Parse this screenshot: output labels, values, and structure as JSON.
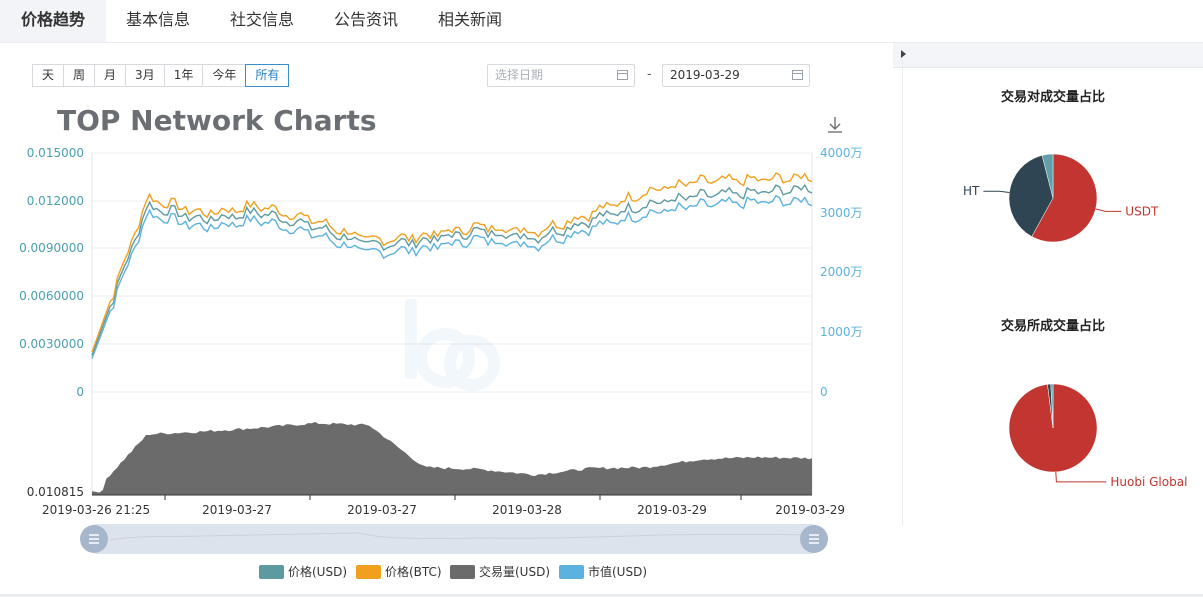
{
  "tabs": [
    {
      "label": "价格趋势",
      "active": true
    },
    {
      "label": "基本信息",
      "active": false
    },
    {
      "label": "社交信息",
      "active": false
    },
    {
      "label": "公告资讯",
      "active": false
    },
    {
      "label": "相关新闻",
      "active": false
    }
  ],
  "period_buttons": [
    {
      "label": "天"
    },
    {
      "label": "周"
    },
    {
      "label": "月"
    },
    {
      "label": "3月"
    },
    {
      "label": "1年"
    },
    {
      "label": "今年"
    },
    {
      "label": "所有",
      "active": true
    }
  ],
  "date_range": {
    "start_placeholder": "选择日期",
    "separator": "-",
    "end_value": "2019-03-29"
  },
  "colors": {
    "price_usd": "#5d9aa0",
    "price_btc": "#f0a01e",
    "volume": "#6b6b6b",
    "market_cap": "#5cb2de",
    "pie_usdt": "#c23531",
    "pie_ht": "#2f4554",
    "pie_small": "#61a0a8"
  },
  "chart": {
    "title": "TOP Network Charts",
    "download_icon": "download-icon",
    "left_ticks": [
      "0.015000",
      "0.012000",
      "0.0090000",
      "0.0060000",
      "0.0030000",
      "0"
    ],
    "right_ticks": [
      "4000万",
      "3000万",
      "2000万",
      "1000万",
      "0"
    ],
    "volume_min_label": "0.010815",
    "x_ticks": [
      "2019-03-26 21:25",
      "2019-03-27",
      "2019-03-27",
      "2019-03-28",
      "2019-03-29",
      "2019-03-29"
    ],
    "legend": [
      {
        "label": "价格(USD)",
        "color": "#5d9aa0"
      },
      {
        "label": "价格(BTC)",
        "color": "#f0a01e"
      },
      {
        "label": "交易量(USD)",
        "color": "#6b6b6b"
      },
      {
        "label": "市值(USD)",
        "color": "#5cb2de"
      }
    ]
  },
  "chart_data": {
    "type": "line",
    "title": "TOP Network Charts",
    "x": [
      "2019-03-26 21:25",
      "2019-03-27",
      "2019-03-27",
      "2019-03-28",
      "2019-03-29",
      "2019-03-29"
    ],
    "y_left_range": [
      0,
      0.015
    ],
    "y_right_range": [
      0,
      40000000
    ],
    "series": [
      {
        "name": "价格(USD)",
        "values": [
          0.0023,
          0.0117,
          0.0108,
          0.0113,
          0.0104,
          0.0092,
          0.0095,
          0.0101,
          0.0097,
          0.0108,
          0.0118,
          0.0123,
          0.0125,
          0.0128
        ]
      },
      {
        "name": "价格(BTC)",
        "values": [
          0.0025,
          0.0122,
          0.0112,
          0.0117,
          0.0108,
          0.0095,
          0.0098,
          0.0104,
          0.0101,
          0.0112,
          0.0126,
          0.0132,
          0.0133,
          0.0135
        ]
      },
      {
        "name": "市值(USD)",
        "values": [
          0.0021,
          0.0112,
          0.0103,
          0.0108,
          0.0099,
          0.0087,
          0.009,
          0.0096,
          0.0092,
          0.0103,
          0.0112,
          0.0117,
          0.0119,
          0.012
        ]
      },
      {
        "name": "交易量(USD)",
        "values": [
          0.01,
          0.66,
          0.69,
          0.73,
          0.78,
          0.76,
          0.3,
          0.28,
          0.22,
          0.29,
          0.3,
          0.39,
          0.41,
          0.4
        ]
      }
    ]
  },
  "pie1": {
    "title": "交易对成交量占比",
    "slices": [
      {
        "label": "USDT",
        "value": 58,
        "color": "#c23531",
        "labeled": true
      },
      {
        "label": "HT",
        "value": 38,
        "color": "#2f4554",
        "labeled": true
      },
      {
        "label": "",
        "value": 4,
        "color": "#61a0a8",
        "labeled": false
      }
    ]
  },
  "pie2": {
    "title": "交易所成交量占比",
    "slices": [
      {
        "label": "Huobi Global",
        "value": 98,
        "color": "#c23531",
        "labeled": true
      },
      {
        "label": "",
        "value": 1.2,
        "color": "#2f4554",
        "labeled": false
      },
      {
        "label": "",
        "value": 0.8,
        "color": "#61a0a8",
        "labeled": false
      }
    ]
  }
}
